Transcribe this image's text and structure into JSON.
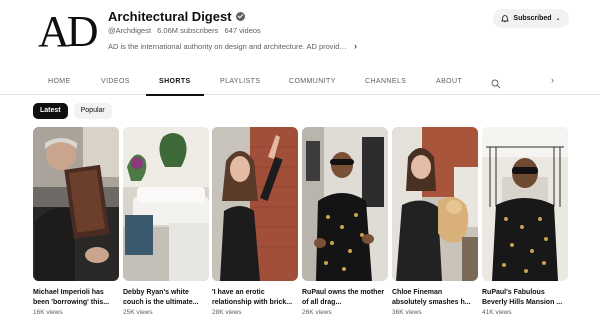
{
  "channel": {
    "logo_text": "AD",
    "title": "Architectural Digest",
    "handle": "@Archdigest",
    "subscribers": "6.06M subscribers",
    "videos": "647 videos",
    "description": "AD is the international authority on design and architecture. AD provides e...",
    "subscribe_label": "Subscribed"
  },
  "tabs": [
    "HOME",
    "VIDEOS",
    "SHORTS",
    "PLAYLISTS",
    "COMMUNITY",
    "CHANNELS",
    "ABOUT"
  ],
  "active_tab": "SHORTS",
  "chips": [
    "Latest",
    "Popular"
  ],
  "active_chip": "Latest",
  "shorts": [
    {
      "title": "Michael Imperioli has been 'borrowing' this...",
      "views": "16K views"
    },
    {
      "title": "Debby Ryan's white couch is the ultimate...",
      "views": "25K views"
    },
    {
      "title": "'I have an erotic relationship with brick...",
      "views": "28K views"
    },
    {
      "title": "RuPaul owns the mother of all drag...",
      "views": "26K views"
    },
    {
      "title": "Chloe Fineman absolutely smashes h...",
      "views": "36K views"
    },
    {
      "title": "RuPaul's Fabulous Beverly Hills Mansion ...",
      "views": "41K views"
    }
  ],
  "colors": {
    "text": "#0f0f0f",
    "secondary": "#606060",
    "chip_bg": "#f2f2f2",
    "active_chip_bg": "#0f0f0f"
  }
}
